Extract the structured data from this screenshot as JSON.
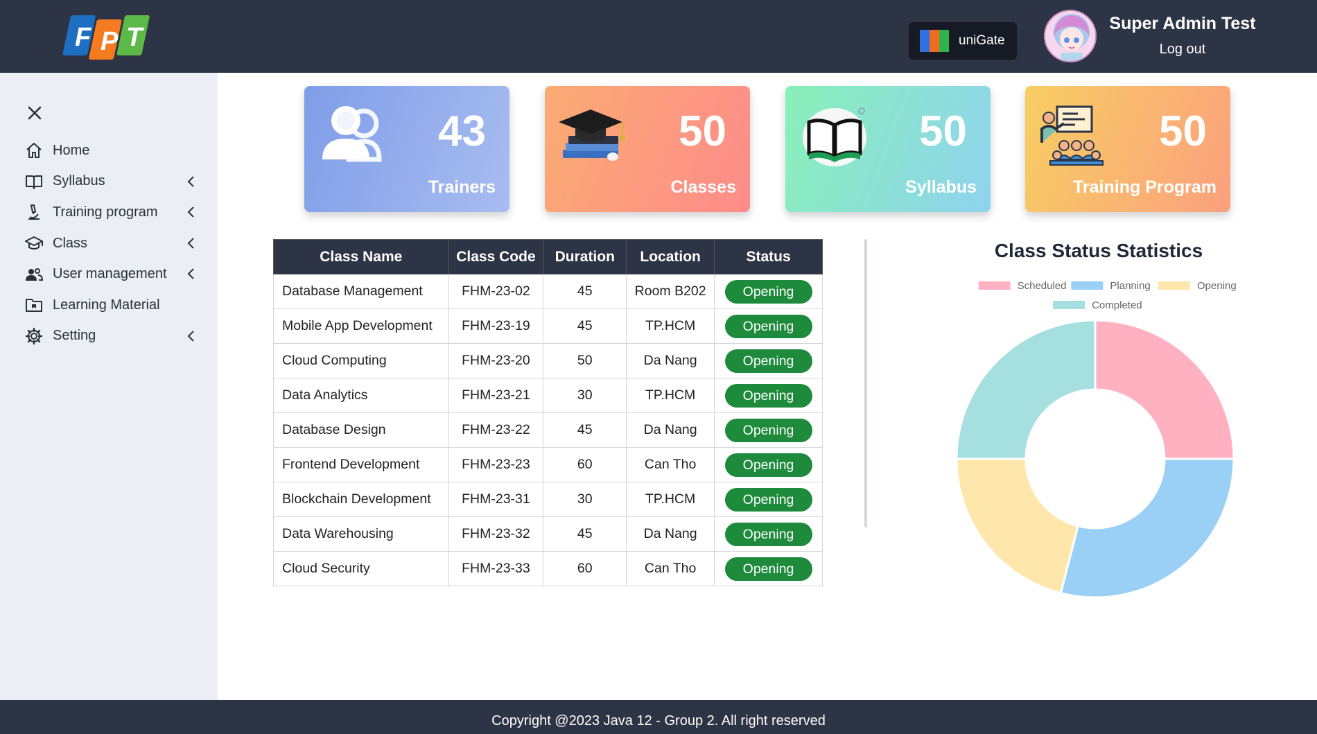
{
  "header": {
    "logo_text": "FPT",
    "unigate_label": "uniGate",
    "user_name": "Super Admin Test",
    "logout_label": "Log out"
  },
  "sidebar": {
    "items": [
      {
        "label": "Home",
        "icon": "home-icon",
        "has_chevron": false
      },
      {
        "label": "Syllabus",
        "icon": "book-icon",
        "has_chevron": true
      },
      {
        "label": "Training program",
        "icon": "microscope-icon",
        "has_chevron": true
      },
      {
        "label": "Class",
        "icon": "graduation-cap-icon",
        "has_chevron": true
      },
      {
        "label": "User management",
        "icon": "users-icon",
        "has_chevron": true
      },
      {
        "label": "Learning Material",
        "icon": "folder-icon",
        "has_chevron": false
      },
      {
        "label": "Setting",
        "icon": "gear-icon",
        "has_chevron": true
      }
    ]
  },
  "cards": [
    {
      "value": "43",
      "label": "Trainers",
      "icon": "people-icon"
    },
    {
      "value": "50",
      "label": "Classes",
      "icon": "graduation-books-icon"
    },
    {
      "value": "50",
      "label": "Syllabus",
      "icon": "open-book-icon"
    },
    {
      "value": "50",
      "label": "Training Program",
      "icon": "teacher-classroom-icon"
    }
  ],
  "table": {
    "headers": [
      "Class Name",
      "Class Code",
      "Duration",
      "Location",
      "Status"
    ],
    "rows": [
      [
        "Database Management",
        "FHM-23-02",
        "45",
        "Room B202",
        "Opening"
      ],
      [
        "Mobile App Development",
        "FHM-23-19",
        "45",
        "TP.HCM",
        "Opening"
      ],
      [
        "Cloud Computing",
        "FHM-23-20",
        "50",
        "Da Nang",
        "Opening"
      ],
      [
        "Data Analytics",
        "FHM-23-21",
        "30",
        "TP.HCM",
        "Opening"
      ],
      [
        "Database Design",
        "FHM-23-22",
        "45",
        "Da Nang",
        "Opening"
      ],
      [
        "Frontend Development",
        "FHM-23-23",
        "60",
        "Can Tho",
        "Opening"
      ],
      [
        "Blockchain Development",
        "FHM-23-31",
        "30",
        "TP.HCM",
        "Opening"
      ],
      [
        "Data Warehousing",
        "FHM-23-32",
        "45",
        "Da Nang",
        "Opening"
      ],
      [
        "Cloud Security",
        "FHM-23-33",
        "60",
        "Can Tho",
        "Opening"
      ]
    ]
  },
  "chart_data": {
    "type": "doughnut",
    "title": "Class Status Statistics",
    "legend_position": "top",
    "series": [
      {
        "name": "Scheduled",
        "value": 25,
        "color": "#ffb1c1"
      },
      {
        "name": "Planning",
        "value": 29,
        "color": "#9ad0f5"
      },
      {
        "name": "Opening",
        "value": 21,
        "color": "#ffe6aa"
      },
      {
        "name": "Completed",
        "value": 25,
        "color": "#a5dfdf"
      }
    ]
  },
  "footer": {
    "text": "Copyright @2023 Java 12 - Group 2. All right reserved"
  },
  "colors": {
    "header_bg": "#2d3446",
    "sidebar_bg": "#ebeff5",
    "status_green": "#1e8a3b"
  }
}
